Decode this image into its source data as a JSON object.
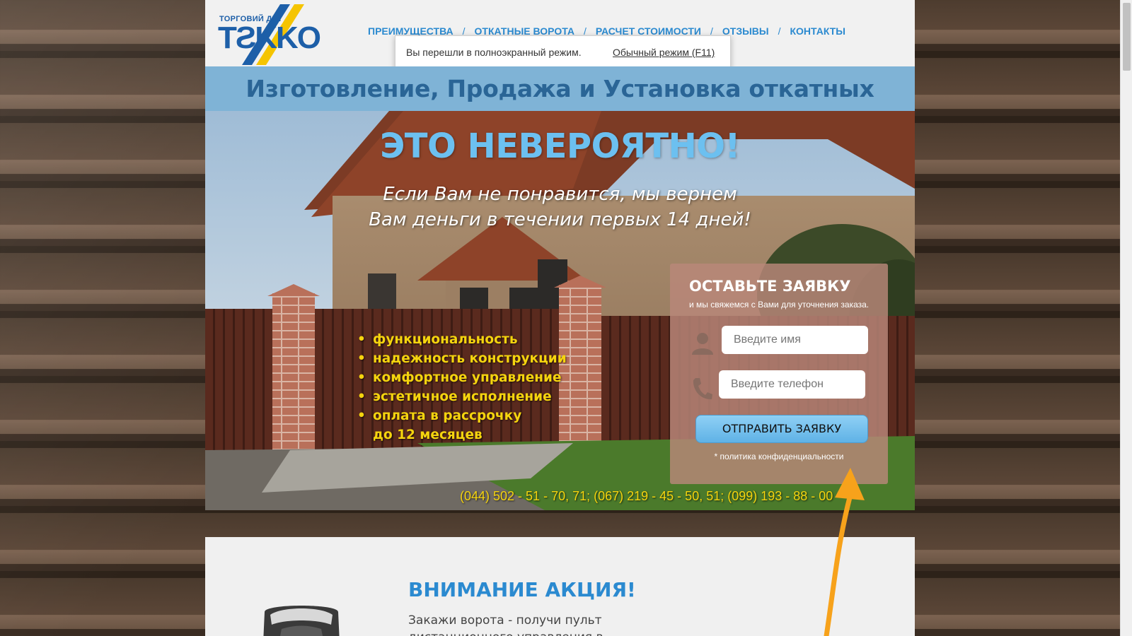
{
  "logo": {
    "small_text": "ТОРГОВИЙ ДІМ",
    "brand": "TЕККО"
  },
  "nav": {
    "items": [
      {
        "label": "ПРЕИМУЩЕСТВА"
      },
      {
        "label": "ОТКАТНЫЕ ВОРОТА"
      },
      {
        "label": "РАСЧЕТ СТОИМОСТИ"
      },
      {
        "label": "ОТЗЫВЫ"
      },
      {
        "label": "КОНТАКТЫ"
      }
    ],
    "separator": "/"
  },
  "fullscreen_toast": {
    "message": "Вы перешли в полноэкранный режим.",
    "link": "Обычный режим (F11)"
  },
  "banner": {
    "title": "Изготовление, Продажа и Установка откатных ворот"
  },
  "hero": {
    "title": "ЭТО НЕВЕРОЯТНО!",
    "subtitle_line1": "Если Вам не понравится, мы вернем",
    "subtitle_line2": "Вам деньги в течении первых 14 дней!",
    "features": [
      "функциональность",
      "надежность конструкции",
      "комфортное управление",
      "эстетичное исполнение",
      "оплата в рассрочку",
      "до 12 месяцев"
    ],
    "phones": "(044) 502 - 51 - 70, 71; (067) 219 - 45 - 50, 51; (099) 193 - 88 - 00"
  },
  "form": {
    "title": "ОСТАВЬТЕ ЗАЯВКУ",
    "subtitle": "и мы свяжемся с Вами для уточнения заказа.",
    "name_placeholder": "Введите имя",
    "phone_placeholder": "Введите телефон",
    "submit_label": "ОТПРАВИТЬ ЗАЯВКУ",
    "privacy": "* политика конфиденциальности"
  },
  "promo": {
    "title": "ВНИМАНИЕ АКЦИЯ!",
    "text_line1": "Закажи ворота - получи пульт",
    "text_line2": "дистанционного управления в подарок"
  },
  "colors": {
    "accent_blue": "#2b8ad0",
    "hero_title": "#6cc0f0",
    "feature_yellow": "#f5d40e",
    "banner_bg": "#7fb3d6",
    "arrow_orange": "#f7a21b"
  }
}
